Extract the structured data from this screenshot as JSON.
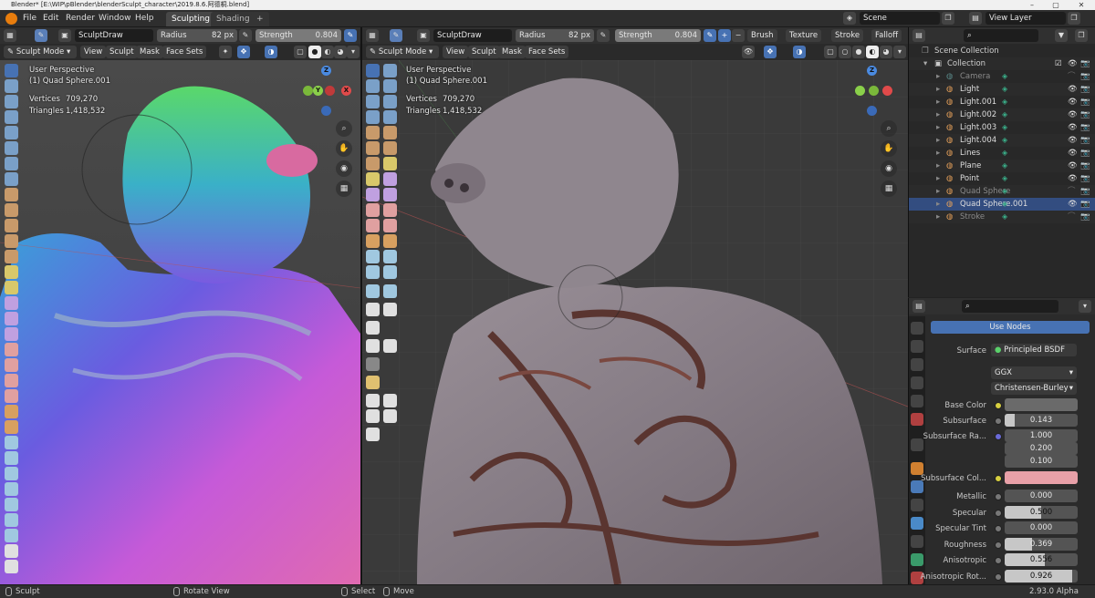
{
  "window": {
    "title": "Blender* [E:\\WIP\\pBlender\\blenderSculpt_character\\2019.8.6.阿德桐.blend]",
    "controls": [
      "–",
      "▢",
      "✕"
    ]
  },
  "menu": {
    "items": [
      "File",
      "Edit",
      "Render",
      "Window",
      "Help"
    ],
    "workspaces": [
      {
        "label": "Sculpting",
        "active": true
      },
      {
        "label": "Shading",
        "active": false
      },
      {
        "label": "+",
        "active": false
      }
    ],
    "scene_label": "Scene",
    "view_layer_label": "View Layer"
  },
  "left_view": {
    "brush_name": "SculptDraw",
    "radius_label": "Radius",
    "radius_value": "82 px",
    "strength_label": "Strength",
    "strength_value": "0.804",
    "mode": "Sculpt Mode",
    "menus": [
      "View",
      "Sculpt",
      "Mask",
      "Face Sets"
    ],
    "overlay_title": "User Perspective",
    "overlay_object": "(1) Quad Sphere.001",
    "vertices_label": "Vertices",
    "vertices_value": "709,270",
    "triangles_label": "Triangles",
    "triangles_value": "1,418,532"
  },
  "right_view": {
    "brush_name": "SculptDraw",
    "radius_label": "Radius",
    "radius_value": "82 px",
    "strength_label": "Strength",
    "strength_value": "0.804",
    "menus_right": [
      "Brush",
      "Texture",
      "Stroke",
      "Falloff"
    ],
    "mode": "Sculpt Mode",
    "menus": [
      "View",
      "Sculpt",
      "Mask",
      "Face Sets"
    ],
    "overlay_title": "User Perspective",
    "overlay_object": "(1) Quad Sphere.001",
    "vertices_label": "Vertices",
    "vertices_value": "709,270",
    "triangles_label": "Triangles",
    "triangles_value": "1,418,532"
  },
  "gizmo": {
    "x": "X",
    "y": "Y",
    "z": "Z"
  },
  "outliner": {
    "root": "Scene Collection",
    "collection": "Collection",
    "items": [
      {
        "name": "Camera",
        "color": "#5a8a8a",
        "dim": true
      },
      {
        "name": "Light",
        "color": "#e8a25a",
        "dim": false
      },
      {
        "name": "Light.001",
        "color": "#e8a25a",
        "dim": false
      },
      {
        "name": "Light.002",
        "color": "#e8a25a",
        "dim": false
      },
      {
        "name": "Light.003",
        "color": "#e8a25a",
        "dim": false
      },
      {
        "name": "Light.004",
        "color": "#e8a25a",
        "dim": false
      },
      {
        "name": "Lines",
        "color": "#e8a25a",
        "dim": false
      },
      {
        "name": "Plane",
        "color": "#e8a25a",
        "dim": false
      },
      {
        "name": "Point",
        "color": "#e8a25a",
        "dim": false
      },
      {
        "name": "Quad Sphere",
        "color": "#e8a25a",
        "dim": true
      },
      {
        "name": "Quad Sphere.001",
        "color": "#e8a25a",
        "dim": false,
        "selected": true
      },
      {
        "name": "Stroke",
        "color": "#e8a25a",
        "dim": true
      }
    ]
  },
  "properties": {
    "use_nodes": "Use Nodes",
    "surface_label": "Surface",
    "surface_value": "Principled BSDF",
    "distribution": "GGX",
    "subsurface_method": "Christensen-Burley",
    "base_color_label": "Base Color",
    "subsurface_label": "Subsurface",
    "subsurface_value": "0.143",
    "subsurface_radius_label": "Subsurface Ra...",
    "subsurface_radius": [
      "1.000",
      "0.200",
      "0.100"
    ],
    "subsurface_color_label": "Subsurface Col...",
    "subsurface_color": "#e8a0a8",
    "rows": [
      {
        "label": "Metallic",
        "value": "0.000",
        "fill": 0.0
      },
      {
        "label": "Specular",
        "value": "0.500",
        "fill": 0.5
      },
      {
        "label": "Specular Tint",
        "value": "0.000",
        "fill": 0.0
      },
      {
        "label": "Roughness",
        "value": "0.369",
        "fill": 0.369
      },
      {
        "label": "Anisotropic",
        "value": "0.556",
        "fill": 0.556
      },
      {
        "label": "Anisotropic Rot...",
        "value": "0.926",
        "fill": 0.926
      }
    ]
  },
  "status": {
    "sculpt": "Sculpt",
    "rotate": "Rotate View",
    "select": "Select",
    "move": "Move",
    "version": "2.93.0 Alpha"
  }
}
